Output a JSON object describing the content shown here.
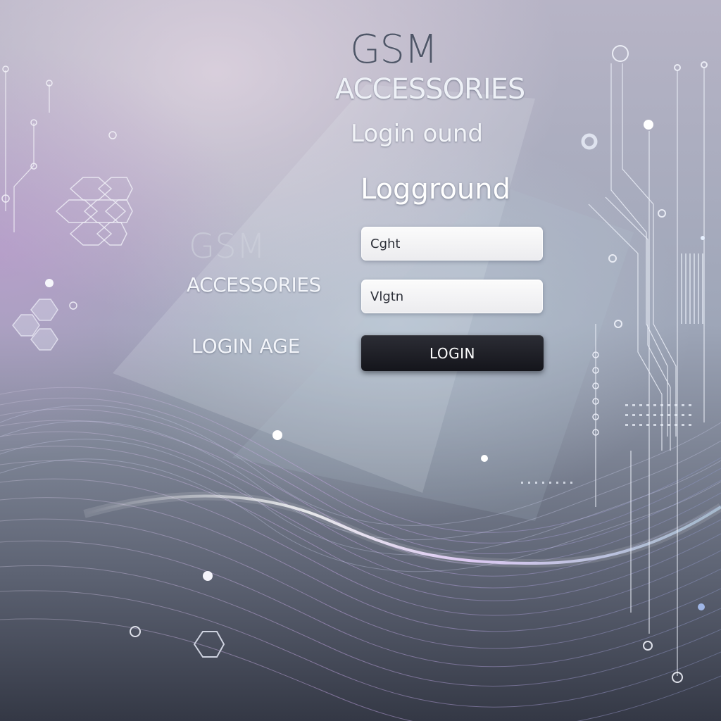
{
  "brand": {
    "title": "GSM",
    "subtitle": "ACCESSORIES"
  },
  "headings": {
    "line1": "Login ound",
    "line2": "Logground"
  },
  "left_panel": {
    "title": "GSM",
    "subtitle": "ACCESSORIES",
    "page_label": "LOGIN AGE"
  },
  "form": {
    "field_1_value": "Cght",
    "field_2_value": "Vlgtn",
    "login_label": "LOGIN"
  },
  "colors": {
    "accent_wave": "#c8b4e6",
    "button": "#1a1b22",
    "text_light": "#f3f5fa"
  }
}
